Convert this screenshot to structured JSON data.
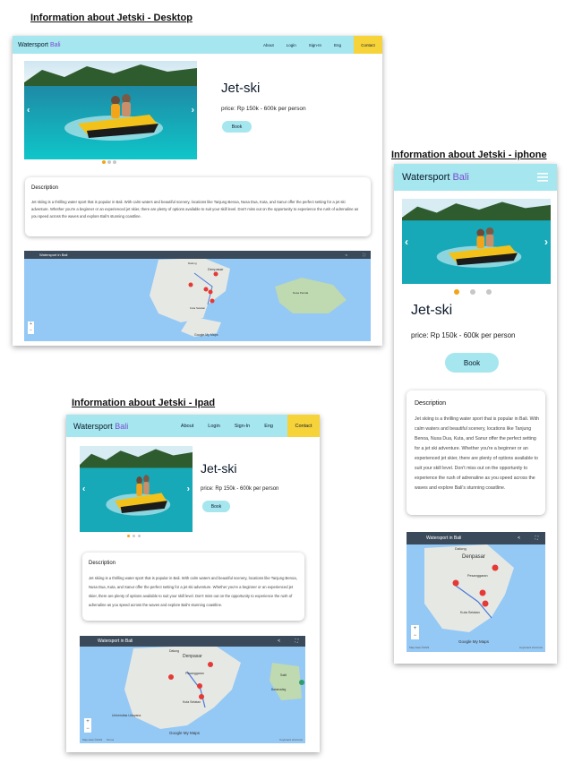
{
  "headings": {
    "desktop": "Information about Jetski - Desktop",
    "iphone": "Information about Jetski - iphone",
    "ipad": "Information about Jetski - Ipad"
  },
  "brand": {
    "name": "Watersport",
    "accent": "Bali"
  },
  "nav": {
    "about": "About",
    "login": "Login",
    "signin": "Sign-In",
    "lang": "Eng",
    "contact": "Contact"
  },
  "product": {
    "title": "Jet-ski",
    "price": "price: Rp 150k - 600k per person",
    "book": "Book"
  },
  "description": {
    "heading": "Description",
    "text": "Jet skiing is a thrilling water sport that is popular in Bali. With calm waters and beautiful scenery, locations like Tanjung Benoa, Nusa Dua, Kuta, and Sanur offer the perfect setting for a jet ski adventure. Whether you're a beginner or an experienced jet skier, there are plenty of options available to suit your skill level. Don't miss out on the opportunity to experience the rush of adrenaline as you speed across the waves and explore Bali's stunning coastline."
  },
  "map": {
    "title": "Watersport in Bali",
    "place_main": "Denpasar",
    "place_north": "Dalung",
    "place_pesanggaran": "Pesanggaran",
    "place_kuta": "Kuta Selatan",
    "place_unpr": "Universitas Udayana",
    "place_nusa": "Nusa Penida",
    "place_sakti": "Sakti",
    "place_batumadeg": "Batumadeg",
    "brand_logo": "Google My Maps",
    "data_note": "Map data ©2023",
    "terms": "Terms",
    "shortcuts": "Keyboard shortcuts",
    "zoom_in": "+",
    "zoom_out": "−"
  },
  "colors": {
    "nav": "#a5e6ef",
    "accent": "#7b4dd1",
    "contact": "#f7d33a",
    "dot_active": "#f2a51a",
    "sea": "#94c8f5",
    "land": "#e6e8e4"
  },
  "icons": {
    "prev": "‹",
    "next": "›",
    "menu": "hamburger-icon",
    "share": "share-icon",
    "fullscreen": "fullscreen-icon"
  }
}
